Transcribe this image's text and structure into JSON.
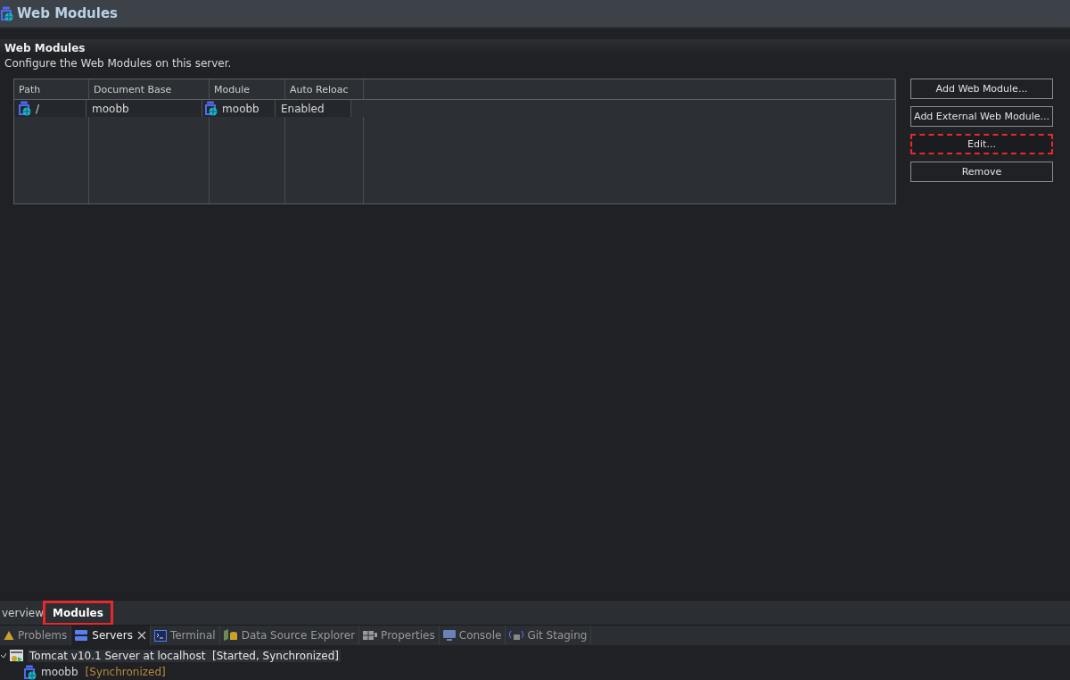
{
  "editor_title": "Web Modules",
  "section": {
    "title": "Web Modules",
    "description": "Configure the Web Modules on this server."
  },
  "table": {
    "columns": [
      "Path",
      "Document Base",
      "Module",
      "Auto Reloac"
    ],
    "rows": [
      {
        "path": "/",
        "document_base": "moobb",
        "module": "moobb",
        "auto_reload": "Enabled",
        "selected": false
      }
    ]
  },
  "buttons": [
    {
      "label": "Add Web Module...",
      "highlighted": false
    },
    {
      "label": "Add External Web Module...",
      "highlighted": false
    },
    {
      "label": "Edit...",
      "highlighted": true
    },
    {
      "label": "Remove",
      "highlighted": false
    }
  ],
  "editor_tabs": [
    {
      "label": "verview",
      "selected": false,
      "highlighted": false
    },
    {
      "label": "Modules",
      "selected": true,
      "highlighted": true
    }
  ],
  "view_tabs": [
    {
      "label": "Problems",
      "kind": "warning",
      "selected": false
    },
    {
      "label": "Servers",
      "kind": "server",
      "selected": true
    },
    {
      "label": "Terminal",
      "kind": "terminal",
      "selected": false
    },
    {
      "label": "Data Source Explorer",
      "kind": "database",
      "selected": false
    },
    {
      "label": "Properties",
      "kind": "properties",
      "selected": false
    },
    {
      "label": "Console",
      "kind": "monitor",
      "selected": false
    },
    {
      "label": "Git Staging",
      "kind": "git",
      "selected": false
    }
  ],
  "servers": [
    {
      "name": "Tomcat v10.1 Server at localhost",
      "status": "[Started, Synchronized]",
      "expanded": true,
      "children": [
        {
          "name": "moobb",
          "status": "[Synchronized]"
        }
      ]
    }
  ]
}
